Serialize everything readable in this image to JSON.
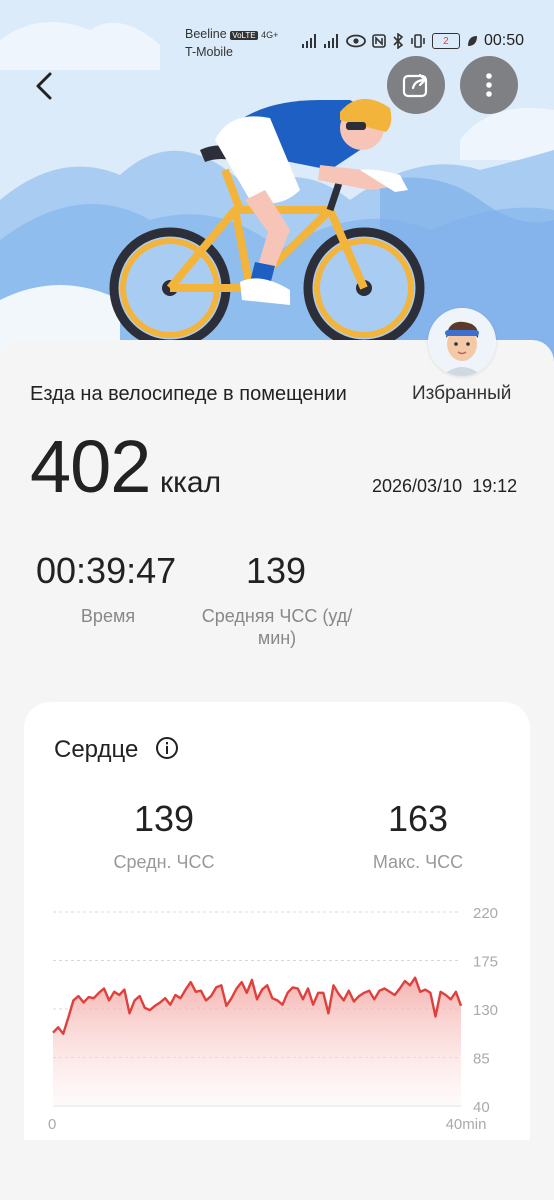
{
  "status_bar": {
    "carrier1": "Beeline",
    "carrier2": "T-Mobile",
    "volte": "VoLTE",
    "network": "4G+",
    "battery": "2",
    "time": "00:50"
  },
  "header": {
    "back_icon": "chevron-left-icon",
    "share_icon": "share-icon",
    "more_icon": "more-vertical-icon"
  },
  "workout": {
    "title": "Езда на велосипеде в помещении",
    "favorite_label": "Избранный",
    "calories_value": "402",
    "calories_unit": "ккал",
    "date": "2026/03/10  19:12",
    "duration_value": "00:39:47",
    "duration_label": "Время",
    "avg_hr_value": "139",
    "avg_hr_label_line1": "Средняя ЧСС (уд/",
    "avg_hr_label_line2": "мин)"
  },
  "heart": {
    "title": "Сердце",
    "avg_value": "139",
    "avg_label": "Средн. ЧСС",
    "max_value": "163",
    "max_label": "Макс. ЧСС"
  },
  "chart_data": {
    "type": "area",
    "title": "",
    "xlabel": "",
    "ylabel": "",
    "x_ticks": [
      "0",
      "40min"
    ],
    "y_ticks": [
      220,
      175,
      130,
      85,
      40
    ],
    "xlim": [
      0,
      40
    ],
    "ylim": [
      40,
      220
    ],
    "grid": true,
    "series": [
      {
        "x": [
          0,
          0.5,
          1,
          1.5,
          2,
          2.5,
          3,
          3.5,
          4,
          4.5,
          5,
          5.5,
          6,
          6.5,
          7,
          7.5,
          8,
          8.5,
          9,
          9.5,
          10,
          10.5,
          11,
          11.5,
          12,
          12.5,
          13,
          13.5,
          14,
          14.5,
          15,
          15.5,
          16,
          16.5,
          17,
          17.5,
          18,
          18.5,
          19,
          19.5,
          20,
          20.5,
          21,
          21.5,
          22,
          22.5,
          23,
          23.5,
          24,
          24.5,
          25,
          25.5,
          26,
          26.5,
          27,
          27.5,
          28,
          28.5,
          29,
          29.5,
          30,
          30.5,
          31,
          31.5,
          32,
          32.5,
          33,
          33.5,
          34,
          34.5,
          35,
          35.5,
          36,
          36.5,
          37,
          37.5,
          38,
          38.5,
          39,
          39.5,
          40
        ],
        "values": [
          108,
          113,
          107,
          122,
          138,
          142,
          136,
          141,
          140,
          145,
          149,
          138,
          146,
          143,
          148,
          126,
          138,
          142,
          131,
          129,
          133,
          136,
          140,
          134,
          143,
          140,
          148,
          155,
          146,
          147,
          138,
          142,
          150,
          152,
          133,
          140,
          149,
          155,
          145,
          157,
          139,
          148,
          152,
          140,
          138,
          134,
          145,
          150,
          149,
          139,
          149,
          134,
          145,
          145,
          126,
          152,
          144,
          138,
          147,
          137,
          142,
          145,
          147,
          139,
          147,
          149,
          146,
          143,
          149,
          156,
          152,
          159,
          146,
          148,
          145,
          123,
          146,
          143,
          139,
          146,
          133
        ],
        "color": "#e0403c"
      }
    ]
  }
}
